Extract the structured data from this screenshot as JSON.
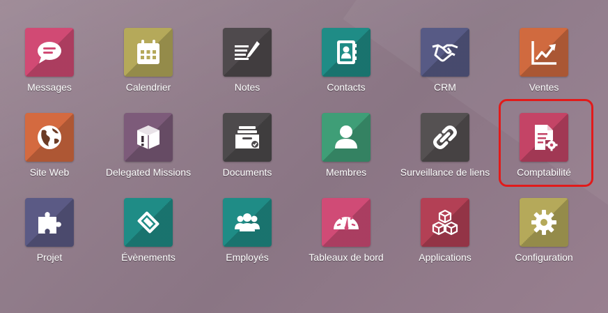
{
  "apps": [
    {
      "label": "Messages",
      "icon": "speech-bubble-icon",
      "color": "#d14a74"
    },
    {
      "label": "Calendrier",
      "icon": "calendar-icon",
      "color": "#b5a95a"
    },
    {
      "label": "Notes",
      "icon": "notes-pen-icon",
      "color": "#4f4a4d"
    },
    {
      "label": "Contacts",
      "icon": "address-book-icon",
      "color": "#1f8c86"
    },
    {
      "label": "CRM",
      "icon": "handshake-icon",
      "color": "#575a85"
    },
    {
      "label": "Ventes",
      "icon": "trend-chart-icon",
      "color": "#d06a3f"
    },
    {
      "label": "Site Web",
      "icon": "globe-icon",
      "color": "#d46a40"
    },
    {
      "label": "Delegated Missions",
      "icon": "box-alert-icon",
      "color": "#7d5b7a"
    },
    {
      "label": "Documents",
      "icon": "file-tray-icon",
      "color": "#4d4a4c"
    },
    {
      "label": "Membres",
      "icon": "member-user-icon",
      "color": "#3f9e77"
    },
    {
      "label": "Surveillance de liens",
      "icon": "chain-link-icon",
      "color": "#555152"
    },
    {
      "label": "Comptabilité",
      "icon": "document-gear-icon",
      "color": "#c44466"
    },
    {
      "label": "Projet",
      "icon": "puzzle-icon",
      "color": "#5b5a85"
    },
    {
      "label": "Évènements",
      "icon": "ticket-icon",
      "color": "#1f8c86"
    },
    {
      "label": "Employés",
      "icon": "people-group-icon",
      "color": "#1f8c86"
    },
    {
      "label": "Tableaux de bord",
      "icon": "speedometer-icon",
      "color": "#d04b76"
    },
    {
      "label": "Applications",
      "icon": "cubes-icon",
      "color": "#b34055"
    },
    {
      "label": "Configuration",
      "icon": "gear-icon",
      "color": "#b5a95a"
    }
  ],
  "highlight_color": "#e21a1a"
}
